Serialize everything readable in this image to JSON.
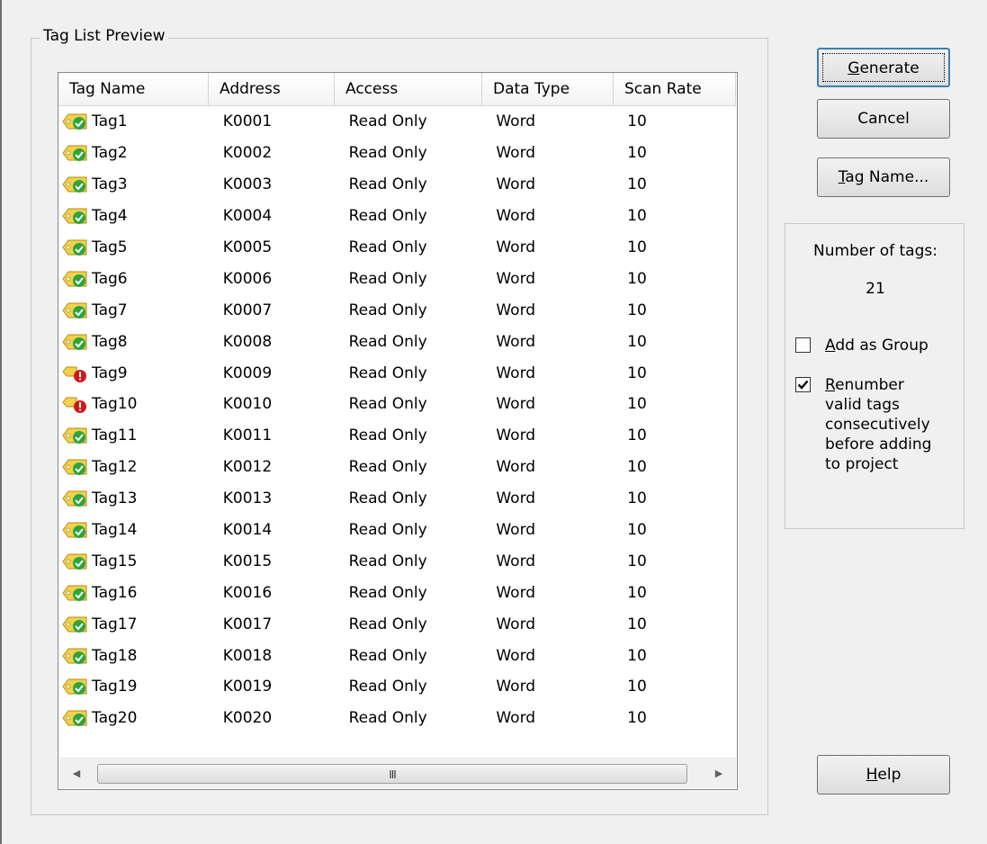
{
  "group_title": "Tag List Preview",
  "columns": [
    "Tag Name",
    "Address",
    "Access",
    "Data Type",
    "Scan Rate"
  ],
  "rows": [
    {
      "name": "Tag1",
      "address": "K0001",
      "access": "Read Only",
      "type": "Word",
      "rate": "10",
      "status": "valid"
    },
    {
      "name": "Tag2",
      "address": "K0002",
      "access": "Read Only",
      "type": "Word",
      "rate": "10",
      "status": "valid"
    },
    {
      "name": "Tag3",
      "address": "K0003",
      "access": "Read Only",
      "type": "Word",
      "rate": "10",
      "status": "valid"
    },
    {
      "name": "Tag4",
      "address": "K0004",
      "access": "Read Only",
      "type": "Word",
      "rate": "10",
      "status": "valid"
    },
    {
      "name": "Tag5",
      "address": "K0005",
      "access": "Read Only",
      "type": "Word",
      "rate": "10",
      "status": "valid"
    },
    {
      "name": "Tag6",
      "address": "K0006",
      "access": "Read Only",
      "type": "Word",
      "rate": "10",
      "status": "valid"
    },
    {
      "name": "Tag7",
      "address": "K0007",
      "access": "Read Only",
      "type": "Word",
      "rate": "10",
      "status": "valid"
    },
    {
      "name": "Tag8",
      "address": "K0008",
      "access": "Read Only",
      "type": "Word",
      "rate": "10",
      "status": "valid"
    },
    {
      "name": "Tag9",
      "address": "K0009",
      "access": "Read Only",
      "type": "Word",
      "rate": "10",
      "status": "error"
    },
    {
      "name": "Tag10",
      "address": "K0010",
      "access": "Read Only",
      "type": "Word",
      "rate": "10",
      "status": "error"
    },
    {
      "name": "Tag11",
      "address": "K0011",
      "access": "Read Only",
      "type": "Word",
      "rate": "10",
      "status": "valid"
    },
    {
      "name": "Tag12",
      "address": "K0012",
      "access": "Read Only",
      "type": "Word",
      "rate": "10",
      "status": "valid"
    },
    {
      "name": "Tag13",
      "address": "K0013",
      "access": "Read Only",
      "type": "Word",
      "rate": "10",
      "status": "valid"
    },
    {
      "name": "Tag14",
      "address": "K0014",
      "access": "Read Only",
      "type": "Word",
      "rate": "10",
      "status": "valid"
    },
    {
      "name": "Tag15",
      "address": "K0015",
      "access": "Read Only",
      "type": "Word",
      "rate": "10",
      "status": "valid"
    },
    {
      "name": "Tag16",
      "address": "K0016",
      "access": "Read Only",
      "type": "Word",
      "rate": "10",
      "status": "valid"
    },
    {
      "name": "Tag17",
      "address": "K0017",
      "access": "Read Only",
      "type": "Word",
      "rate": "10",
      "status": "valid"
    },
    {
      "name": "Tag18",
      "address": "K0018",
      "access": "Read Only",
      "type": "Word",
      "rate": "10",
      "status": "valid"
    },
    {
      "name": "Tag19",
      "address": "K0019",
      "access": "Read Only",
      "type": "Word",
      "rate": "10",
      "status": "valid"
    },
    {
      "name": "Tag20",
      "address": "K0020",
      "access": "Read Only",
      "type": "Word",
      "rate": "10",
      "status": "valid"
    }
  ],
  "scrollbar": {
    "grip": "III",
    "left_icon": "scroll-left-arrow",
    "right_icon": "scroll-right-arrow"
  },
  "buttons": {
    "generate_mnemonic": "G",
    "generate_rest": "enerate",
    "cancel": "Cancel",
    "tagname_mnemonic": "T",
    "tagname_rest": "ag Name...",
    "help_mnemonic": "H",
    "help_rest": "elp"
  },
  "panel": {
    "number_label": "Number of tags:",
    "number_value": "21",
    "add_group_mnemonic": "A",
    "add_group_rest": "dd as Group",
    "add_group_checked": false,
    "renumber_mnemonic": "R",
    "renumber_rest_line1": "enumber",
    "renumber_lines": [
      "valid tags",
      "consecutively",
      "before adding",
      "to project"
    ],
    "renumber_checked": true
  },
  "colors": {
    "tag_yellow": "#f2d24a",
    "valid_green": "#2ea43a",
    "error_red": "#d01818",
    "accent": "#3c7fb1"
  },
  "icons": {
    "valid": "tag-valid-icon",
    "error": "tag-error-icon",
    "check": "checkmark-icon"
  }
}
